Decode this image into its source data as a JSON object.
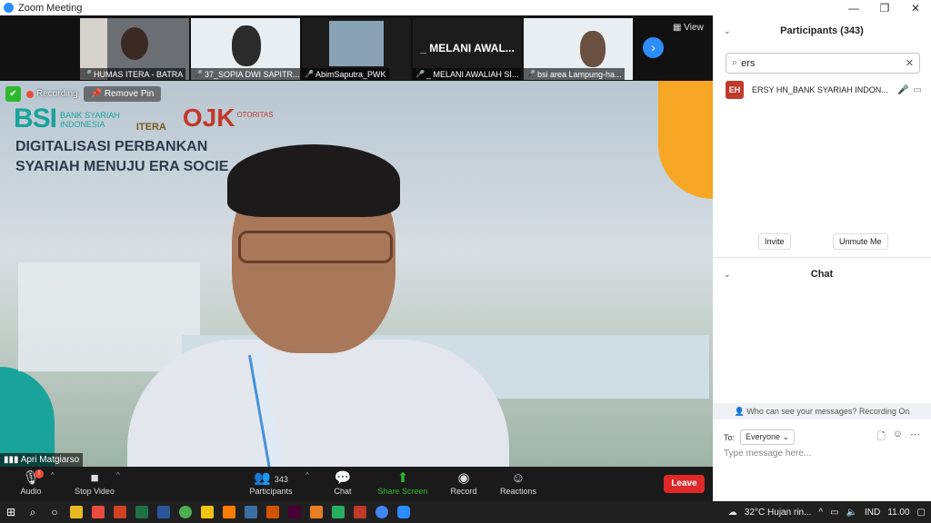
{
  "window": {
    "title": "Zoom Meeting",
    "minimize": "—",
    "restore": "❐",
    "close": "✕"
  },
  "thumbnails": [
    {
      "name": "HUMAS ITERA - BATRA"
    },
    {
      "name": "37_SOPIA DWI SAPITR..."
    },
    {
      "name": "AbimSaputra_PWK"
    },
    {
      "name": "_ MELANI AWALIAH SI...",
      "display": "_ MELANI AWAL..."
    },
    {
      "name": "bsi area Lampung-ha..."
    }
  ],
  "view_label": "View",
  "main_video": {
    "speaker": "Apri Matgiarso",
    "recording_label": "Recording",
    "remove_pin_label": "Remove Pin",
    "slide": {
      "bsi": "BSI",
      "bsi_sub_1": "BANK SYARIAH",
      "bsi_sub_2": "INDONESIA",
      "itera": "ITERA",
      "ojk": "OJK",
      "ojk_sub": "OTORITAS",
      "title_line1": "DIGITALISASI PERBANKAN",
      "title_line2": "SYARIAH MENUJU ERA SOCIE"
    }
  },
  "toolbar": {
    "audio": "Audio",
    "audio_badge": "!",
    "stop_video": "Stop Video",
    "participants": "Participants",
    "participants_count": "343",
    "chat": "Chat",
    "share_screen": "Share Screen",
    "record": "Record",
    "reactions": "Reactions",
    "leave": "Leave"
  },
  "participants_panel": {
    "title": "Participants (343)",
    "search_value": "ers",
    "results": [
      {
        "initials": "EH",
        "name": "ERSY HN_BANK SYARIAH INDON..."
      }
    ],
    "invite": "Invite",
    "unmute_me": "Unmute Me"
  },
  "chat_panel": {
    "title": "Chat",
    "info": "Who can see your messages? Recording On",
    "to_label": "To:",
    "to_value": "Everyone",
    "placeholder": "Type message here..."
  },
  "taskbar": {
    "weather": "32°C Hujan rin...",
    "lang": "IND",
    "time": "11.00"
  }
}
